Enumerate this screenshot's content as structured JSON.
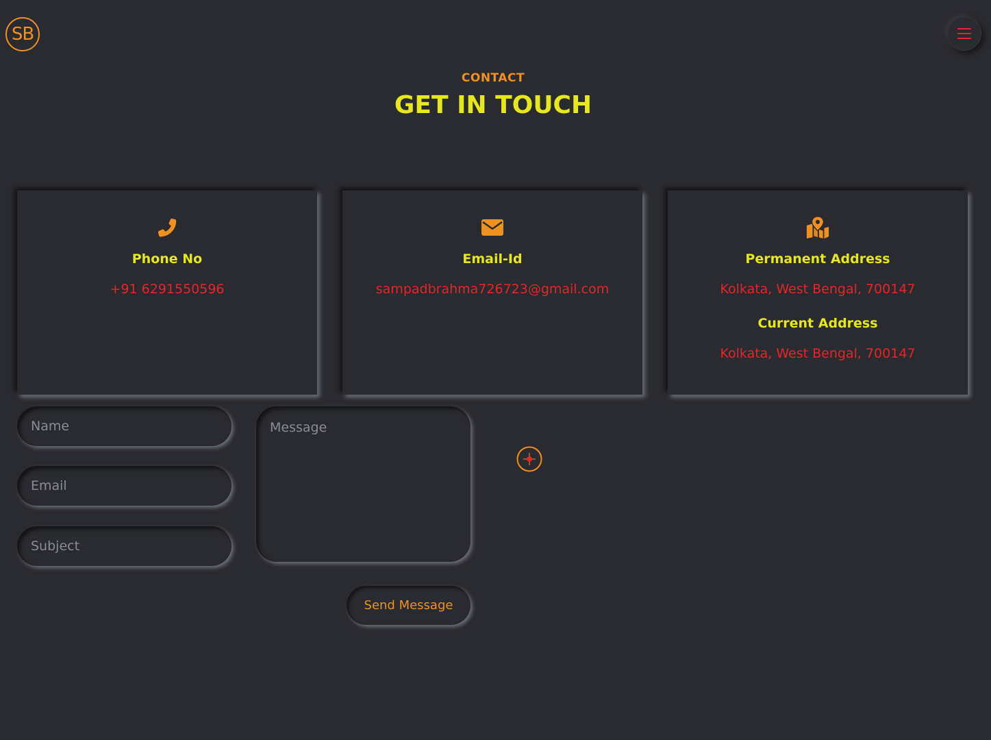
{
  "header": {
    "logo_text": "SB",
    "menu_icon": "hamburger-icon"
  },
  "section": {
    "eyebrow": "CONTACT",
    "title": "GET IN TOUCH"
  },
  "cards": [
    {
      "icon": "phone-icon",
      "title": "Phone No",
      "value": "+91 6291550596"
    },
    {
      "icon": "envelope-icon",
      "title": "Email-Id",
      "value": "sampadbrahma726723@gmail.com"
    },
    {
      "icon": "map-pin-icon",
      "title": "Permanent Address",
      "value": "Kolkata, West Bengal, 700147",
      "title2": "Current Address",
      "value2": "Kolkata, West Bengal, 700147"
    }
  ],
  "form": {
    "name_placeholder": "Name",
    "email_placeholder": "Email",
    "subject_placeholder": "Subject",
    "message_placeholder": "Message",
    "send_label": "Send Message"
  },
  "colors": {
    "background": "#2a2b30",
    "accent_orange": "#f0911f",
    "accent_yellow": "#e5e81b",
    "accent_red": "#e3262a"
  }
}
